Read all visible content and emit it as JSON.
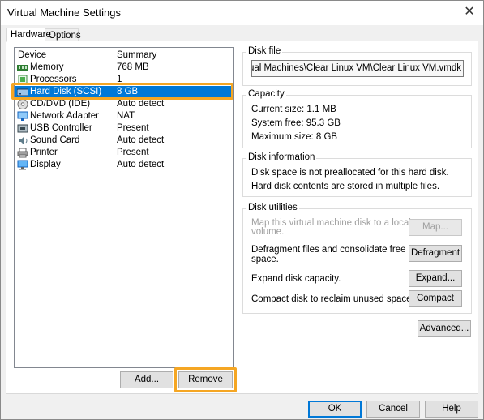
{
  "window": {
    "title": "Virtual Machine Settings",
    "close_label": "✕"
  },
  "tabs": [
    {
      "label": "Hardware"
    },
    {
      "label": "Options"
    }
  ],
  "device_list": {
    "columns": {
      "device": "Device",
      "summary": "Summary"
    },
    "rows": [
      {
        "device": "Memory",
        "summary": "768 MB",
        "icon": "memory-icon"
      },
      {
        "device": "Processors",
        "summary": "1",
        "icon": "processor-icon"
      },
      {
        "device": "Hard Disk (SCSI)",
        "summary": "8 GB",
        "icon": "hard-disk-icon"
      },
      {
        "device": "CD/DVD (IDE)",
        "summary": "Auto detect",
        "icon": "cd-dvd-icon"
      },
      {
        "device": "Network Adapter",
        "summary": "NAT",
        "icon": "network-adapter-icon"
      },
      {
        "device": "USB Controller",
        "summary": "Present",
        "icon": "usb-controller-icon"
      },
      {
        "device": "Sound Card",
        "summary": "Auto detect",
        "icon": "sound-card-icon"
      },
      {
        "device": "Printer",
        "summary": "Present",
        "icon": "printer-icon"
      },
      {
        "device": "Display",
        "summary": "Auto detect",
        "icon": "display-icon"
      }
    ],
    "selected_device": "Hard Disk (SCSI)"
  },
  "list_buttons": {
    "add": "Add...",
    "remove": "Remove"
  },
  "disk_file": {
    "title": "Disk file",
    "path": "ents\\Virtual Machines\\Clear Linux VM\\Clear Linux VM.vmdk"
  },
  "capacity": {
    "title": "Capacity",
    "current_size": "Current size: 1.1 MB",
    "system_free": "System free: 95.3 GB",
    "maximum_size": "Maximum size: 8 GB"
  },
  "disk_information": {
    "title": "Disk information",
    "line1": "Disk space is not preallocated for this hard disk.",
    "line2": "Hard disk contents are stored in multiple files."
  },
  "disk_utilities": {
    "title": "Disk utilities",
    "map_text_1": "Map this virtual machine disk to a local",
    "map_text_2": "volume.",
    "map_button": "Map...",
    "defrag_text_1": "Defragment files and consolidate free",
    "defrag_text_2": "space.",
    "defrag_button": "Defragment",
    "expand_text": "Expand disk capacity.",
    "expand_button": "Expand...",
    "compact_text": "Compact disk to reclaim unused space.",
    "compact_button": "Compact"
  },
  "advanced_button": "Advanced...",
  "footer": {
    "ok": "OK",
    "cancel": "Cancel",
    "help": "Help"
  },
  "colors": {
    "selection": "#0078d7",
    "highlight": "#f5a623"
  }
}
